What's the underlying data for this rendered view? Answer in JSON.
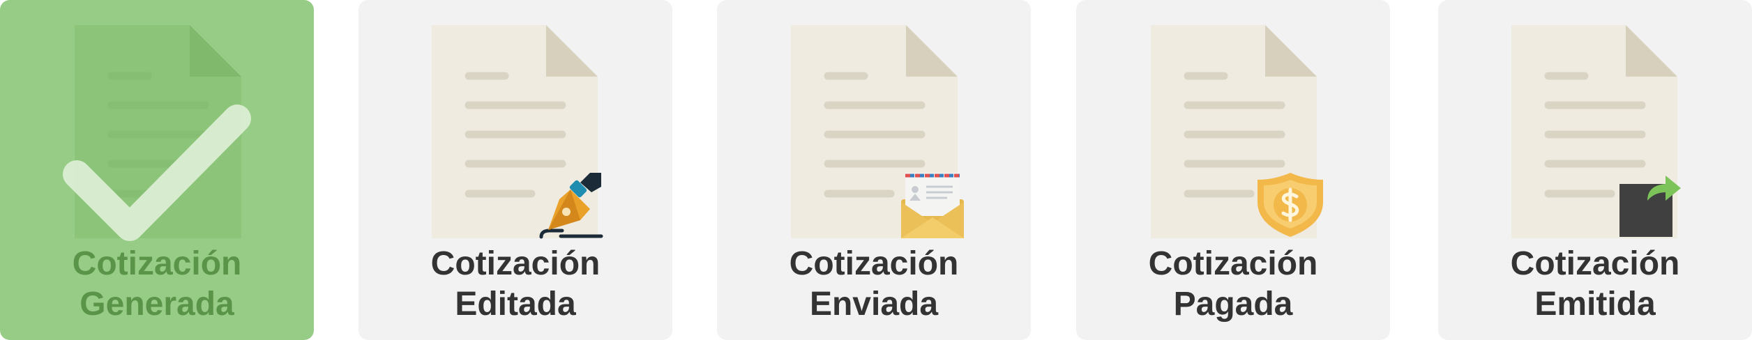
{
  "steps": [
    {
      "line1": "Cotización",
      "line2": "Generada",
      "state": "completed",
      "icon": "check-icon"
    },
    {
      "line1": "Cotización",
      "line2": "Editada",
      "state": "pending",
      "icon": "fountain-pen-icon"
    },
    {
      "line1": "Cotización",
      "line2": "Enviada",
      "state": "pending",
      "icon": "envelope-icon"
    },
    {
      "line1": "Cotización",
      "line2": "Pagada",
      "state": "pending",
      "icon": "dollar-shield-icon"
    },
    {
      "line1": "Cotización",
      "line2": "Emitida",
      "state": "pending",
      "icon": "share-arrow-icon"
    }
  ],
  "colors": {
    "active_bg": "#96cc85",
    "active_text": "#5a9448",
    "card_bg": "#f2f2f2",
    "text": "#333333",
    "paper": "#efebe0",
    "paper_fold": "#d6d0bc"
  }
}
